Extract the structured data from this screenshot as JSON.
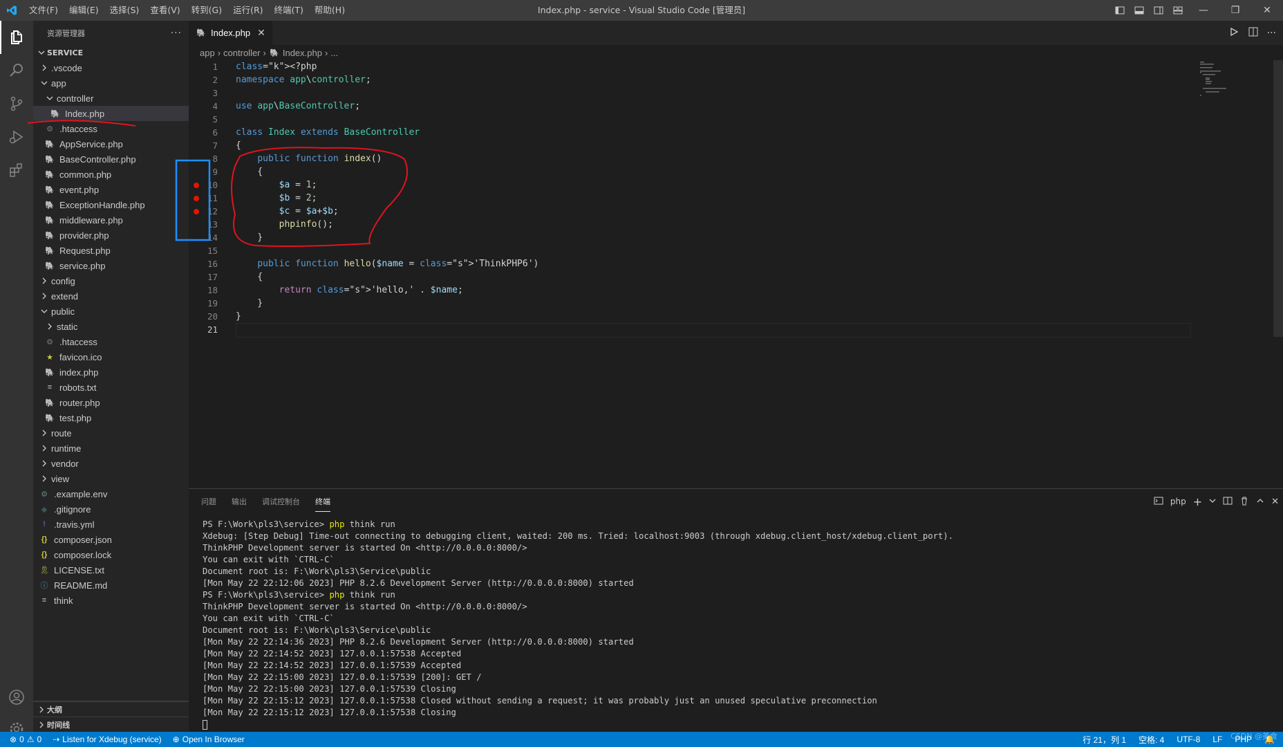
{
  "titlebar": {
    "menu": [
      "文件(F)",
      "编辑(E)",
      "选择(S)",
      "查看(V)",
      "转到(G)",
      "运行(R)",
      "终端(T)",
      "帮助(H)"
    ],
    "window_title": "Index.php - service - Visual Studio Code [管理员]",
    "controls": {
      "minimize": "—",
      "restore": "❐",
      "close": "✕"
    }
  },
  "sidebar": {
    "header": "资源管理器",
    "more": "···",
    "section": "SERVICE",
    "tree": [
      {
        "label": ".vscode",
        "depth": 1,
        "kind": "folder",
        "expanded": false
      },
      {
        "label": "app",
        "depth": 1,
        "kind": "folder",
        "expanded": true
      },
      {
        "label": "controller",
        "depth": 2,
        "kind": "folder",
        "expanded": true
      },
      {
        "label": "Index.php",
        "depth": 3,
        "kind": "php",
        "selected": true
      },
      {
        "label": ".htaccess",
        "depth": 2,
        "kind": "gear"
      },
      {
        "label": "AppService.php",
        "depth": 2,
        "kind": "php"
      },
      {
        "label": "BaseController.php",
        "depth": 2,
        "kind": "php"
      },
      {
        "label": "common.php",
        "depth": 2,
        "kind": "php"
      },
      {
        "label": "event.php",
        "depth": 2,
        "kind": "php"
      },
      {
        "label": "ExceptionHandle.php",
        "depth": 2,
        "kind": "php"
      },
      {
        "label": "middleware.php",
        "depth": 2,
        "kind": "php"
      },
      {
        "label": "provider.php",
        "depth": 2,
        "kind": "php"
      },
      {
        "label": "Request.php",
        "depth": 2,
        "kind": "php"
      },
      {
        "label": "service.php",
        "depth": 2,
        "kind": "php"
      },
      {
        "label": "config",
        "depth": 1,
        "kind": "folder",
        "expanded": false
      },
      {
        "label": "extend",
        "depth": 1,
        "kind": "folder",
        "expanded": false
      },
      {
        "label": "public",
        "depth": 1,
        "kind": "folder",
        "expanded": true
      },
      {
        "label": "static",
        "depth": 2,
        "kind": "folder",
        "expanded": false
      },
      {
        "label": ".htaccess",
        "depth": 2,
        "kind": "gear"
      },
      {
        "label": "favicon.ico",
        "depth": 2,
        "kind": "star"
      },
      {
        "label": "index.php",
        "depth": 2,
        "kind": "php"
      },
      {
        "label": "robots.txt",
        "depth": 2,
        "kind": "txt"
      },
      {
        "label": "router.php",
        "depth": 2,
        "kind": "php"
      },
      {
        "label": "test.php",
        "depth": 2,
        "kind": "php"
      },
      {
        "label": "route",
        "depth": 1,
        "kind": "folder",
        "expanded": false
      },
      {
        "label": "runtime",
        "depth": 1,
        "kind": "folder",
        "expanded": false
      },
      {
        "label": "vendor",
        "depth": 1,
        "kind": "folder",
        "expanded": false
      },
      {
        "label": "view",
        "depth": 1,
        "kind": "folder",
        "expanded": false
      },
      {
        "label": ".example.env",
        "depth": 1,
        "kind": "gear"
      },
      {
        "label": ".gitignore",
        "depth": 1,
        "kind": "git"
      },
      {
        "label": ".travis.yml",
        "depth": 1,
        "kind": "yml"
      },
      {
        "label": "composer.json",
        "depth": 1,
        "kind": "json"
      },
      {
        "label": "composer.lock",
        "depth": 1,
        "kind": "json"
      },
      {
        "label": "LICENSE.txt",
        "depth": 1,
        "kind": "lic"
      },
      {
        "label": "README.md",
        "depth": 1,
        "kind": "info"
      },
      {
        "label": "think",
        "depth": 1,
        "kind": "txt"
      }
    ],
    "outline": "大纲",
    "timeline": "时间线"
  },
  "editor": {
    "tab": {
      "label": "Index.php",
      "close": "✕"
    },
    "breadcrumb": [
      "app",
      "controller",
      "Index.php",
      "..."
    ],
    "current_line": 21,
    "breakpoints": [
      10,
      11,
      12
    ],
    "lines": [
      "<?php",
      "namespace app\\controller;",
      "",
      "use app\\BaseController;",
      "",
      "class Index extends BaseController",
      "{",
      "    public function index()",
      "    {",
      "        $a = 1;",
      "        $b = 2;",
      "        $c = $a+$b;",
      "        phpinfo();",
      "    }",
      "",
      "    public function hello($name = 'ThinkPHP6')",
      "    {",
      "        return 'hello,' . $name;",
      "    }",
      "}",
      ""
    ]
  },
  "panel": {
    "tabs": [
      "问题",
      "输出",
      "调试控制台",
      "终端"
    ],
    "active_tab": "终端",
    "terminal_name": "php",
    "terminal_lines": [
      {
        "prompt": "PS F:\\Work\\pls3\\service> ",
        "cmd": "php",
        "rest": " think run"
      },
      {
        "text": "Xdebug: [Step Debug] Time-out connecting to debugging client, waited: 200 ms. Tried: localhost:9003 (through xdebug.client_host/xdebug.client_port)."
      },
      {
        "text": "ThinkPHP Development server is started On <http://0.0.0.0:8000/>"
      },
      {
        "text": "You can exit with `CTRL-C`"
      },
      {
        "text": "Document root is: F:\\Work\\pls3\\Service\\public"
      },
      {
        "text": "[Mon May 22 22:12:06 2023] PHP 8.2.6 Development Server (http://0.0.0.0:8000) started"
      },
      {
        "prompt": "PS F:\\Work\\pls3\\service> ",
        "cmd": "php",
        "rest": " think run"
      },
      {
        "text": "ThinkPHP Development server is started On <http://0.0.0.0:8000/>"
      },
      {
        "text": "You can exit with `CTRL-C`"
      },
      {
        "text": "Document root is: F:\\Work\\pls3\\Service\\public"
      },
      {
        "text": "[Mon May 22 22:14:36 2023] PHP 8.2.6 Development Server (http://0.0.0.0:8000) started"
      },
      {
        "text": "[Mon May 22 22:14:52 2023] 127.0.0.1:57538 Accepted"
      },
      {
        "text": "[Mon May 22 22:14:52 2023] 127.0.0.1:57539 Accepted"
      },
      {
        "text": "[Mon May 22 22:15:00 2023] 127.0.0.1:57539 [200]: GET /"
      },
      {
        "text": "[Mon May 22 22:15:00 2023] 127.0.0.1:57539 Closing"
      },
      {
        "text": "[Mon May 22 22:15:12 2023] 127.0.0.1:57538 Closed without sending a request; it was probably just an unused speculative preconnection"
      },
      {
        "text": "[Mon May 22 22:15:12 2023] 127.0.0.1:57538 Closing"
      }
    ]
  },
  "statusbar": {
    "errors": "0",
    "warnings": "0",
    "xdebug": "Listen for Xdebug (service)",
    "browser": "Open In Browser",
    "position": "行 21，列 1",
    "spaces": "空格: 4",
    "encoding": "UTF-8",
    "eol": "LF",
    "language": "PHP"
  },
  "watermark": "CSDN @美食",
  "colors": {
    "accent": "#007acc",
    "annotation_red": "#e0141e",
    "annotation_blue": "#1e90ff",
    "breakpoint": "#e51400"
  }
}
